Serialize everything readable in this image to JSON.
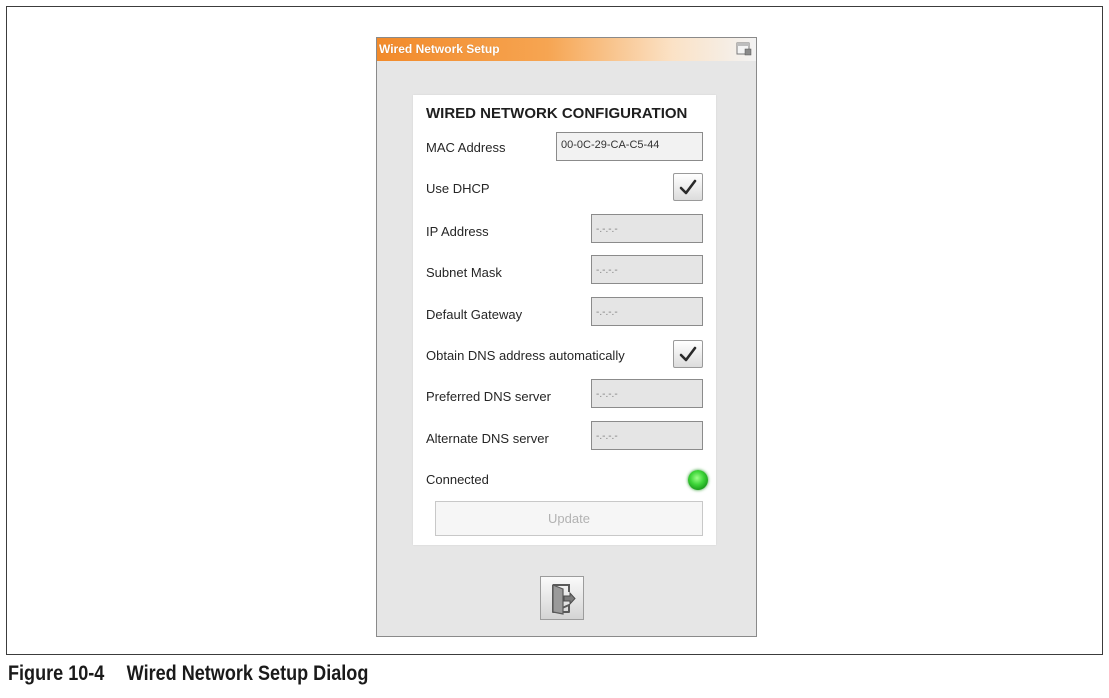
{
  "dialog": {
    "title": "Wired Network Setup",
    "title_icon": "window-icon",
    "accent_color": "#f28a2a"
  },
  "config": {
    "heading": "WIRED NETWORK CONFIGURATION",
    "mac_label": "MAC Address",
    "mac_value": "00-0C-29-CA-C5-44",
    "dhcp_label": "Use DHCP",
    "dhcp_checked": true,
    "ip_label": "IP Address",
    "ip_value": "-.-.-.-",
    "subnet_label": "Subnet Mask",
    "subnet_value": "-.-.-.-",
    "gateway_label": "Default Gateway",
    "gateway_value": "-.-.-.-",
    "dns_auto_label": "Obtain DNS address automatically",
    "dns_auto_checked": true,
    "preferred_dns_label": "Preferred DNS server",
    "preferred_dns_value": "-.-.-.-",
    "alternate_dns_label": "Alternate DNS server",
    "alternate_dns_value": "-.-.-.-",
    "connected_label": "Connected",
    "connected_status_color": "#3fd63a",
    "update_label": "Update"
  },
  "footer": {
    "exit_icon": "exit-icon"
  },
  "figure": {
    "number": "Figure 10-4",
    "caption": "Wired Network Setup Dialog"
  }
}
